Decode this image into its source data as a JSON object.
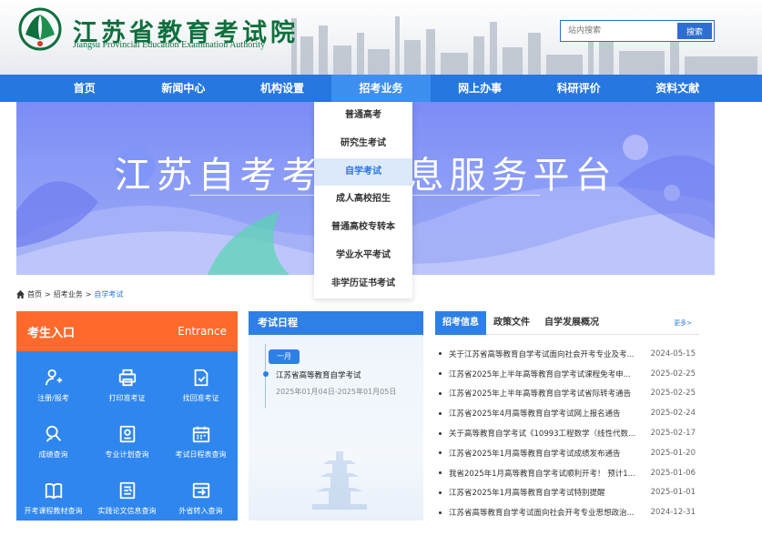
{
  "header": {
    "title": "江苏省教育考试院",
    "subtitle": "Jiangsu Provincial Education Examination Authority",
    "search": {
      "placeholder": "站内搜索",
      "button_label": "搜索"
    }
  },
  "nav": {
    "items": [
      {
        "label": "首页"
      },
      {
        "label": "新闻中心"
      },
      {
        "label": "机构设置"
      },
      {
        "label": "招考业务",
        "active": true
      },
      {
        "label": "网上办事"
      },
      {
        "label": "科研评价"
      },
      {
        "label": "资料文献"
      }
    ]
  },
  "dropdown": {
    "items": [
      {
        "label": "普通高考"
      },
      {
        "label": "研究生考试"
      },
      {
        "label": "自学考试",
        "active": true
      },
      {
        "label": "成人高校招生"
      },
      {
        "label": "普通高校专转本"
      },
      {
        "label": "学业水平考试"
      },
      {
        "label": "非学历证书考试"
      }
    ]
  },
  "banner": {
    "title": "江苏自考考生信息服务平台"
  },
  "breadcrumb": {
    "home": "首页",
    "sep": ">",
    "level1": "招考业务",
    "current": "自学考试"
  },
  "entry": {
    "title": "考生入口",
    "title_en": "Entrance",
    "items": [
      {
        "label": "注册/报考",
        "icon": "user-register-icon"
      },
      {
        "label": "打印准考证",
        "icon": "printer-icon"
      },
      {
        "label": "找回准考证",
        "icon": "document-retrieve-icon"
      },
      {
        "label": "成绩查询",
        "icon": "user-search-icon"
      },
      {
        "label": "专业计划查询",
        "icon": "plan-document-icon"
      },
      {
        "label": "考试日程表查询",
        "icon": "calendar-icon"
      },
      {
        "label": "开考课程教材查询",
        "icon": "book-icon"
      },
      {
        "label": "实践论文信息查询",
        "icon": "thesis-document-icon"
      },
      {
        "label": "外省转入查询",
        "icon": "transfer-in-icon"
      }
    ]
  },
  "schedule": {
    "title": "考试日程",
    "month": "一月",
    "event_title": "江苏省高等教育自学考试",
    "event_date": "2025年01月04日-2025年01月05日"
  },
  "news": {
    "tabs": [
      {
        "label": "招考信息",
        "active": true
      },
      {
        "label": "政策文件"
      },
      {
        "label": "自学发展概况"
      }
    ],
    "more": "更多>",
    "items": [
      {
        "text": "关于江苏省高等教育自学考试面向社会开考专业及考...",
        "date": "2024-05-15"
      },
      {
        "text": "江苏省2025年上半年高等教育自学考试课程免考申...",
        "date": "2025-02-25"
      },
      {
        "text": "江苏省2025年上半年高等教育自学考试省际转考通告",
        "date": "2025-02-25"
      },
      {
        "text": "江苏省2025年4月高等教育自学考试网上报名通告",
        "date": "2025-02-24"
      },
      {
        "text": "关于高等教育自学考试《10993工程数学（线性代数...",
        "date": "2025-02-17"
      },
      {
        "text": "江苏省2025年1月高等教育自学考试成绩发布通告",
        "date": "2025-01-20"
      },
      {
        "text": "我省2025年1月高等教育自学考试顺利开考！ 预计1...",
        "date": "2025-01-06"
      },
      {
        "text": "江苏省2025年1月高等教育自学考试特别提醒",
        "date": "2025-01-01"
      },
      {
        "text": "江苏省高等教育自学考试面向社会开考专业思想政治...",
        "date": "2024-12-31"
      }
    ]
  },
  "colors": {
    "nav_bg": "#2677e0",
    "entry_bg": "#2e86ee",
    "entry_head": "#ff6a2c",
    "logo_green": "#0f6f3d"
  }
}
